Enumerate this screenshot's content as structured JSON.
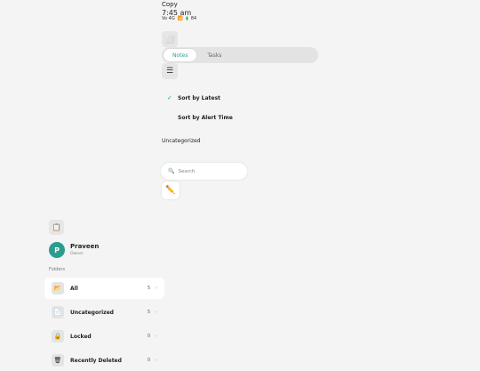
{
  "header": {
    "copy_label": "Copy",
    "time": "7:45 am",
    "network": "Vo 4G",
    "battery": "84"
  },
  "tabs": [
    {
      "label": "Notes",
      "active": true
    },
    {
      "label": "Tasks",
      "active": false
    }
  ],
  "sort_menu": {
    "items": [
      {
        "label": "Sort by Latest",
        "selected": true
      },
      {
        "label": "Sort by Alert Time",
        "selected": false
      }
    ]
  },
  "section_label": "Uncategorized",
  "search": {
    "placeholder": "Search"
  },
  "user": {
    "initial": "P",
    "name": "Praveen",
    "role": "Owner"
  },
  "sidebar": {
    "folders_label": "Folders",
    "folders": [
      {
        "name": "All",
        "count": "5",
        "icon": "folder-icon",
        "active": true
      },
      {
        "name": "Uncategorized",
        "count": "5",
        "icon": "document-icon",
        "active": false
      },
      {
        "name": "Locked",
        "count": "0",
        "icon": "lock-icon",
        "active": false
      },
      {
        "name": "Recently Deleted",
        "count": "0",
        "icon": "trash-icon",
        "active": false
      }
    ]
  },
  "colors": {
    "accent": "#2a9d8f",
    "background": "#f4f4f4"
  }
}
